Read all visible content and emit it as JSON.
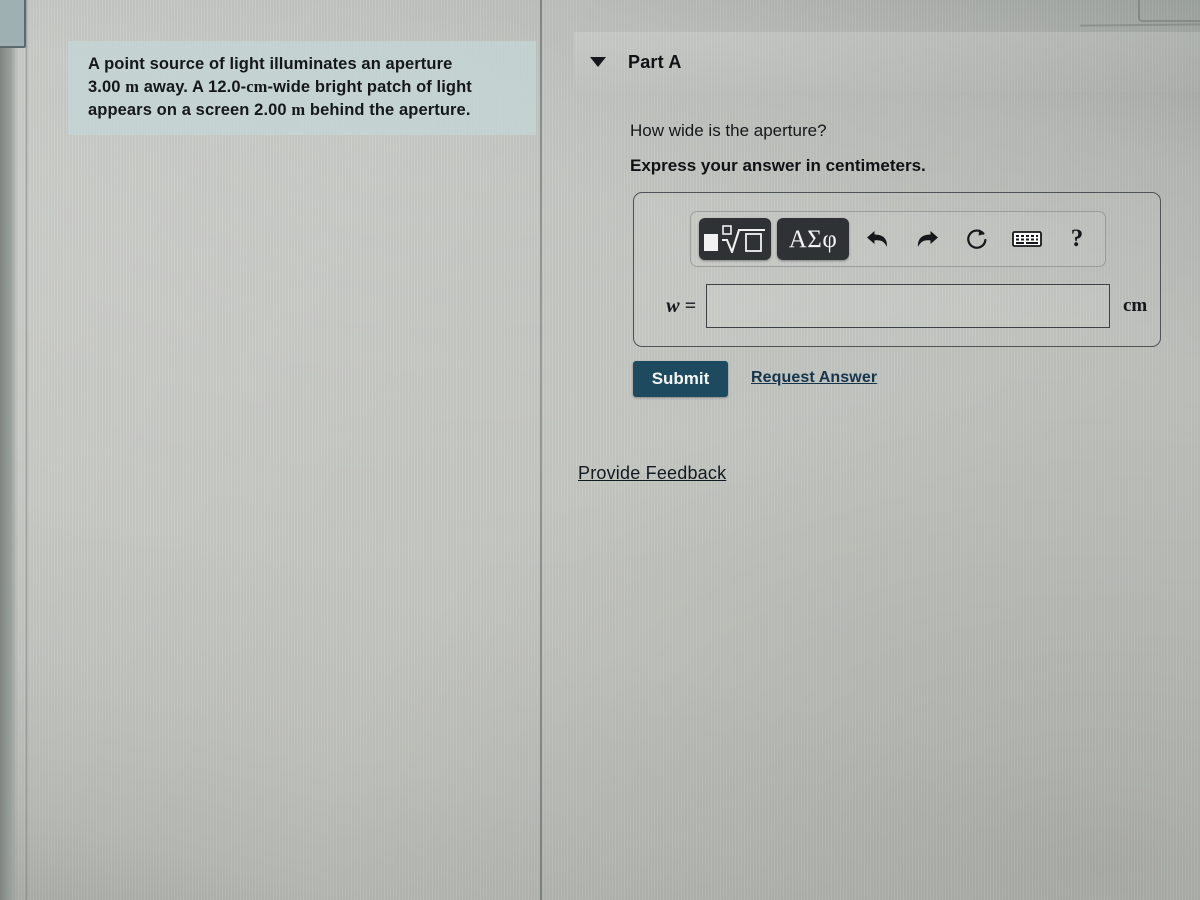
{
  "problem": {
    "statement_line1": "A point source of light illuminates an aperture",
    "statement_line2_a": "3.00 ",
    "statement_line2_m": "m",
    "statement_line2_b": " away. A 12.0-",
    "statement_line2_cm": "cm",
    "statement_line2_c": "-wide bright patch of light",
    "statement_line3_a": "appears on a screen 2.00 ",
    "statement_line3_m": "m",
    "statement_line3_b": " behind the aperture."
  },
  "part": {
    "title": "Part A",
    "caret_icon": "chevron-down-icon",
    "question": "How wide is the aperture?",
    "instruction": "Express your answer in centimeters."
  },
  "toolbar": {
    "template_button_icon": "math-template-icon",
    "greek_button_label": "ΑΣφ",
    "undo_icon": "undo-arrow-icon",
    "redo_icon": "redo-arrow-icon",
    "reset_icon": "reset-circular-arrow-icon",
    "keyboard_icon": "keyboard-icon",
    "help_label": "?"
  },
  "answer": {
    "variable_label": "w =",
    "value": "",
    "placeholder": "",
    "unit": "cm"
  },
  "actions": {
    "submit_label": "Submit",
    "request_answer_label": "Request Answer",
    "provide_feedback_label": "Provide Feedback"
  },
  "colors": {
    "submit_background": "#1d4a5e",
    "link": "#15354d",
    "problem_box_background": "#c4d6d6",
    "toolbar_button": "#2e3234"
  }
}
